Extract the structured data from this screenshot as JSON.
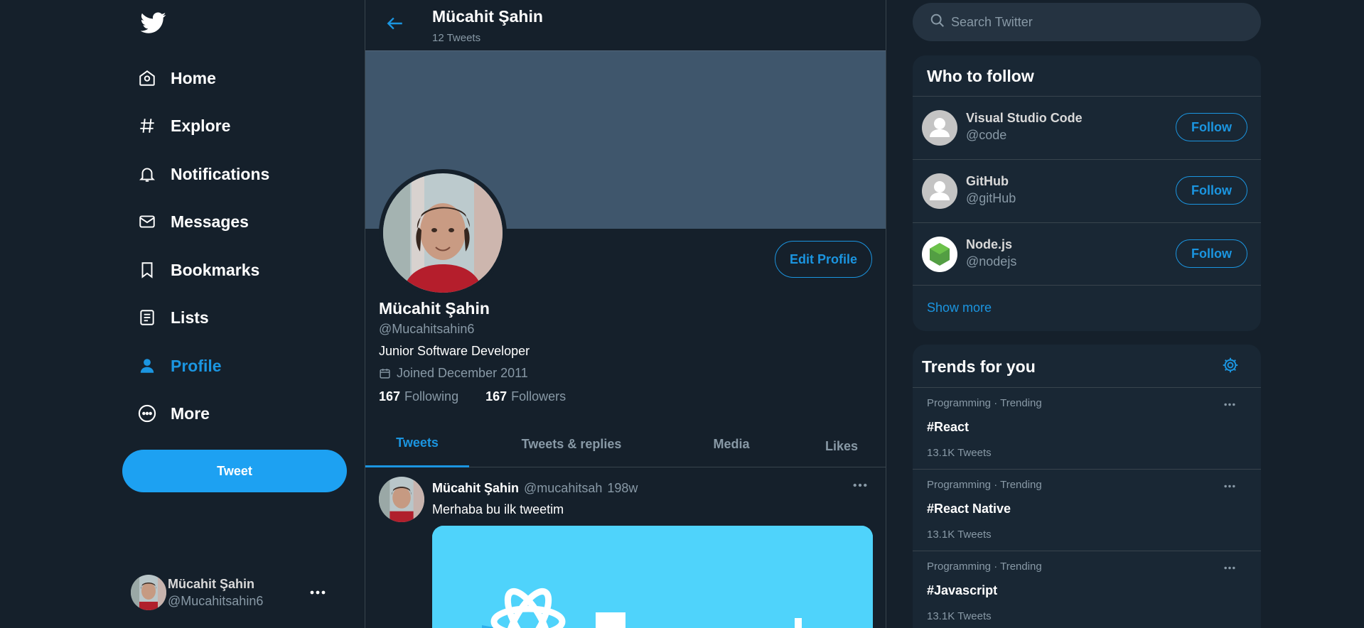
{
  "colors": {
    "background": "#15202b",
    "panel": "#192734",
    "accent": "#1b95e0",
    "tweet_button": "#1da1f2",
    "banner": "#3f566c",
    "muted_text": "#8899a6"
  },
  "sidebar": {
    "logo_icon": "twitter-bird-icon",
    "nav": [
      {
        "label": "Home",
        "icon": "home-icon",
        "active": false
      },
      {
        "label": "Explore",
        "icon": "hashtag-icon",
        "active": false
      },
      {
        "label": "Notifications",
        "icon": "bell-icon",
        "active": false
      },
      {
        "label": "Messages",
        "icon": "envelope-icon",
        "active": false
      },
      {
        "label": "Bookmarks",
        "icon": "bookmark-icon",
        "active": false
      },
      {
        "label": "Lists",
        "icon": "list-icon",
        "active": false
      },
      {
        "label": "Profile",
        "icon": "person-icon",
        "active": true
      },
      {
        "label": "More",
        "icon": "more-circle-icon",
        "active": false
      }
    ],
    "tweet_button": "Tweet",
    "account": {
      "name": "Mücahit Şahin",
      "handle": "@Mucahitsahin6"
    }
  },
  "header": {
    "name": "Mücahit Şahin",
    "tweet_count": "12 Tweets"
  },
  "profile": {
    "name": "Mücahit Şahin",
    "handle": "@Mucahitsahin6",
    "bio": "Junior Software Developer",
    "joined": "Joined December 2011",
    "following_count": "167",
    "following_label": "Following",
    "followers_count": "167",
    "followers_label": "Followers",
    "edit_button": "Edit Profile"
  },
  "tabs": [
    {
      "label": "Tweets",
      "active": true
    },
    {
      "label": "Tweets & replies",
      "active": false
    },
    {
      "label": "Media",
      "active": false
    },
    {
      "label": "Likes",
      "active": false
    }
  ],
  "tweet": {
    "name": "Mücahit Şahin",
    "handle": "@mucahitsah",
    "time": "198w",
    "text": "Merhaba bu ilk tweetim"
  },
  "search": {
    "placeholder": "Search Twitter"
  },
  "who_to_follow": {
    "title": "Who to follow",
    "accounts": [
      {
        "name": "Visual Studio Code",
        "handle": "@code",
        "button": "Follow",
        "avatar": "default-avatar-icon"
      },
      {
        "name": "GitHub",
        "handle": "@gitHub",
        "button": "Follow",
        "avatar": "default-avatar-icon"
      },
      {
        "name": "Node.js",
        "handle": "@nodejs",
        "button": "Follow",
        "avatar": "nodejs-logo-icon"
      }
    ],
    "show_more": "Show more"
  },
  "trends": {
    "title": "Trends for you",
    "items": [
      {
        "category": "Programming · Trending",
        "tag": "#React",
        "count": "13.1K Tweets"
      },
      {
        "category": "Programming · Trending",
        "tag": "#React Native",
        "count": "13.1K Tweets"
      },
      {
        "category": "Programming · Trending",
        "tag": "#Javascript",
        "count": "13.1K Tweets"
      }
    ]
  }
}
